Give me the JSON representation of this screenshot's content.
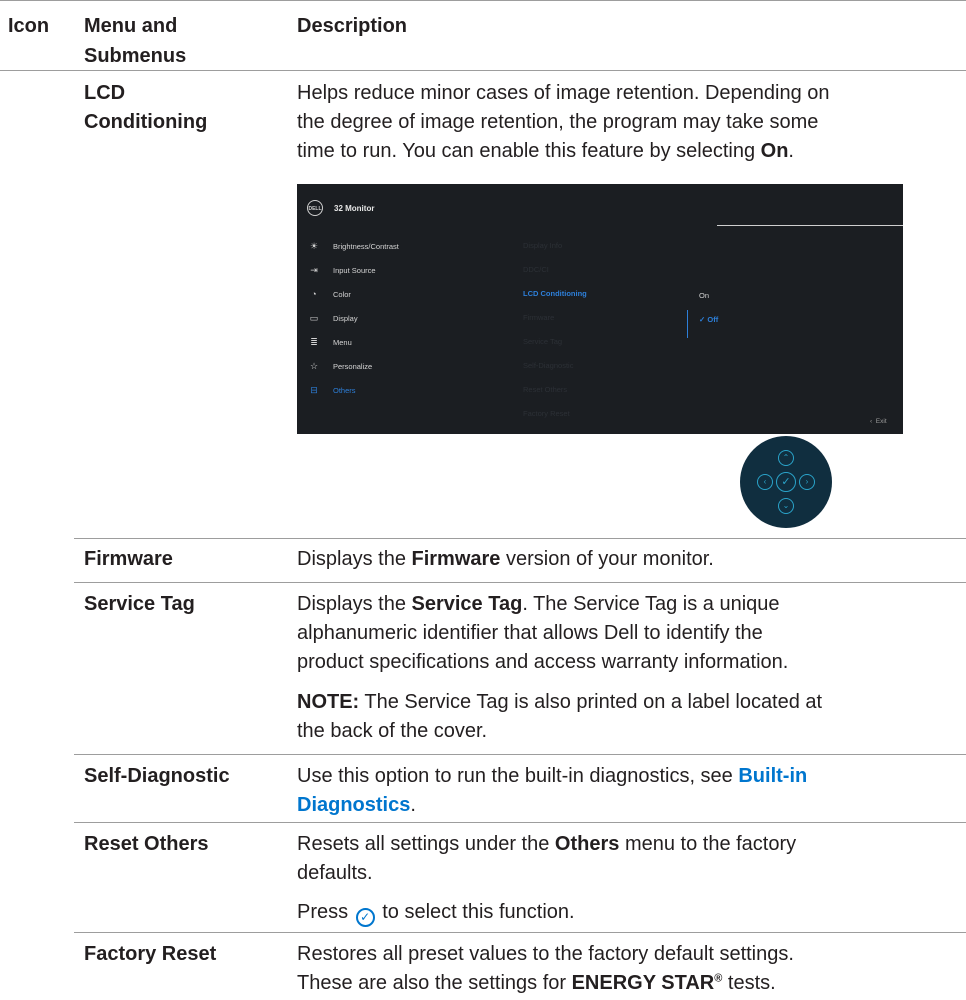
{
  "header": {
    "col_icon": "Icon",
    "col_menu_line1": "Menu and",
    "col_menu_line2": "Submenus",
    "col_desc": "Description"
  },
  "lcd": {
    "title_line1": "LCD",
    "title_line2": "Conditioning",
    "desc_line1": "Helps reduce minor cases of image retention. Depending on",
    "desc_line2": "the degree of image retention, the program may take some",
    "desc_line3_pre": "time to run. You can enable this feature by selecting ",
    "desc_line3_bold": "On",
    "desc_line3_post": "."
  },
  "osd": {
    "logo": "DELL",
    "title": "32 Monitor",
    "menu_items": [
      {
        "icon": "☀",
        "label": "Brightness/Contrast",
        "icon_name": "brightness-icon"
      },
      {
        "icon": "⇥",
        "label": "Input Source",
        "icon_name": "input-source-icon"
      },
      {
        "icon": "◔",
        "label": "Color",
        "icon_name": "color-icon"
      },
      {
        "icon": "▭",
        "label": "Display",
        "icon_name": "display-icon"
      },
      {
        "icon": "≣",
        "label": "Menu",
        "icon_name": "menu-icon"
      },
      {
        "icon": "☆",
        "label": "Personalize",
        "icon_name": "personalize-icon"
      },
      {
        "icon": "⊟",
        "label": "Others",
        "icon_name": "others-icon"
      }
    ],
    "submenu_items": [
      "Display Info",
      "DDC/CI",
      "LCD Conditioning",
      "Firmware",
      "Service Tag",
      "Self-Diagnostic",
      "Reset Others",
      "Factory Reset"
    ],
    "options": [
      "On",
      "Off"
    ],
    "checkmark": "✓",
    "exit_label": "Exit",
    "exit_chevron": "‹",
    "accent_color": "#2d7fd9"
  },
  "joystick": {
    "up": "⌃",
    "left": "‹",
    "center": "✓",
    "right": "›",
    "down": "⌄"
  },
  "firmware": {
    "title": "Firmware",
    "desc_pre": "Displays the ",
    "desc_bold": "Firmware",
    "desc_post": " version of your monitor."
  },
  "service_tag": {
    "title": "Service Tag",
    "desc_line1_pre": "Displays the ",
    "desc_line1_bold": "Service Tag",
    "desc_line1_post": ". The Service Tag is a unique",
    "desc_line2": "alphanumeric identifier that allows Dell to identify the",
    "desc_line3": "product specifications and access warranty information.",
    "note_bold": "NOTE:",
    "note_line1": " The Service Tag is also printed on a label located at",
    "note_line2": "the back of the cover."
  },
  "self_diag": {
    "title": "Self-Diagnostic",
    "desc_line1": "Use this option to run the built-in diagnostics, see ",
    "link_line1": "Built-in",
    "link_line2": "Diagnostics",
    "desc_post": "."
  },
  "reset_others": {
    "title": "Reset Others",
    "desc_line1_pre": "Resets all settings under the ",
    "desc_line1_bold": "Others",
    "desc_line1_post": " menu to the factory",
    "desc_line2": "defaults.",
    "press_pre": "Press ",
    "press_icon": "✓",
    "press_post": " to select this function."
  },
  "factory_reset": {
    "title": "Factory Reset",
    "desc_line1": "Restores all preset values to the factory default settings.",
    "desc_line2_pre": "These are also the settings for ",
    "desc_line2_bold": "ENERGY STAR",
    "desc_line2_sup": "®",
    "desc_line2_post": " tests."
  }
}
